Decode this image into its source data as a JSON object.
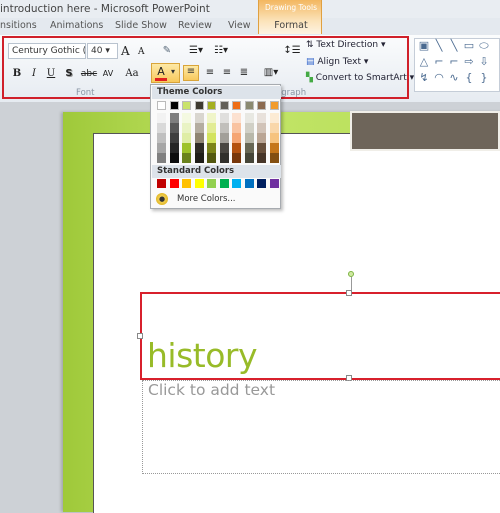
{
  "window": {
    "title": "introduction here  -  Microsoft PowerPoint"
  },
  "tabs": [
    {
      "label": "nsitions"
    },
    {
      "label": "Animations"
    },
    {
      "label": "Slide Show"
    },
    {
      "label": "Review"
    },
    {
      "label": "View"
    }
  ],
  "contextual_tab": {
    "group": "Drawing Tools",
    "tab": "Format",
    "color": "#f3b760"
  },
  "font_group": {
    "font_name": "Century Gothic (H",
    "font_size": "40",
    "label": "Font",
    "bold": "B",
    "italic": "I",
    "underline": "U",
    "shadow": "S",
    "strikethrough": "abc",
    "spacing": "AV",
    "change_case": "Aa",
    "grow": "A",
    "shrink": "A",
    "font_color": "A",
    "font_color_value": "#e02020"
  },
  "paragraph_group": {
    "label": "agraph",
    "text_direction": "Text Direction",
    "align_text": "Align Text",
    "convert_smartart": "Convert to SmartArt"
  },
  "highlight_color": "#d0202a",
  "color_menu": {
    "theme_header": "Theme Colors",
    "theme_top": [
      "#ffffff",
      "#000000",
      "#c9e26b",
      "#3e3a31",
      "#a5b021",
      "#625f58",
      "#ee6d16",
      "#8b8a71",
      "#8b6a50",
      "#f19b2c"
    ],
    "theme_shades": [
      [
        "#f2f2f2",
        "#d9d9d9",
        "#bfbfbf",
        "#a6a6a6",
        "#808080"
      ],
      [
        "#7f7f7f",
        "#595959",
        "#3f3f3f",
        "#262626",
        "#0d0d0d"
      ],
      [
        "#f4f9e1",
        "#e9f3c4",
        "#dfeda6",
        "#9ec22a",
        "#6a821c"
      ],
      [
        "#d9d6cf",
        "#b4ada0",
        "#8f8572",
        "#2e2b25",
        "#1f1d18"
      ],
      [
        "#f0f5c9",
        "#e2ec94",
        "#d3e35e",
        "#7c8419",
        "#535810"
      ],
      [
        "#e0dfdd",
        "#c1bfbb",
        "#a29f99",
        "#4a4742",
        "#31302c"
      ],
      [
        "#fce1d0",
        "#f9c3a1",
        "#f5a573",
        "#b45210",
        "#78370b"
      ],
      [
        "#e8e8e2",
        "#d1d0c6",
        "#b9b8aa",
        "#686754",
        "#454538"
      ],
      [
        "#e8e1db",
        "#d1c3b8",
        "#baa594",
        "#68503c",
        "#463528"
      ],
      [
        "#fcebd4",
        "#f9d7aa",
        "#f6c37f",
        "#c5761a",
        "#834f11"
      ]
    ],
    "standard_header": "Standard Colors",
    "standard": [
      "#c00000",
      "#ff0000",
      "#ffc000",
      "#ffff00",
      "#92d050",
      "#00b050",
      "#00b0f0",
      "#0070c0",
      "#002060",
      "#7030a0"
    ],
    "more_colors": "More Colors..."
  },
  "slide": {
    "title": "history",
    "title_color": "#98bb28",
    "body_placeholder": "Click to add text",
    "frame_color": "#b5dc55",
    "accent_block": "#6e655a"
  }
}
